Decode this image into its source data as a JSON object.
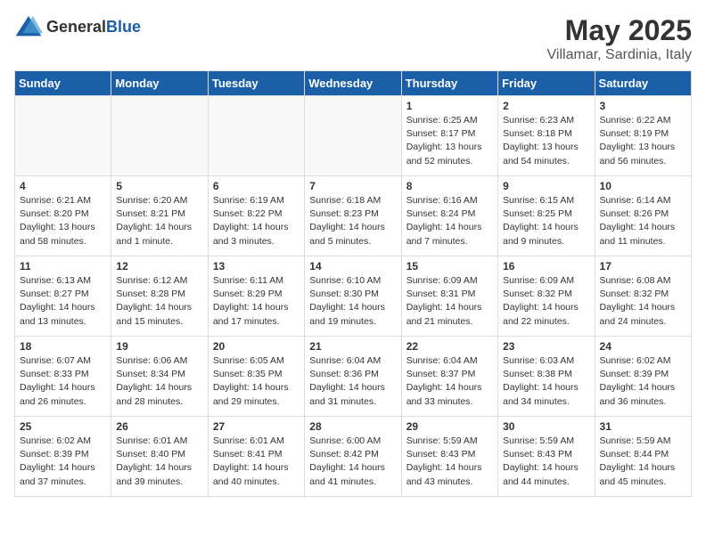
{
  "header": {
    "logo_general": "General",
    "logo_blue": "Blue",
    "month": "May 2025",
    "location": "Villamar, Sardinia, Italy"
  },
  "days_of_week": [
    "Sunday",
    "Monday",
    "Tuesday",
    "Wednesday",
    "Thursday",
    "Friday",
    "Saturday"
  ],
  "weeks": [
    [
      {
        "day": "",
        "content": ""
      },
      {
        "day": "",
        "content": ""
      },
      {
        "day": "",
        "content": ""
      },
      {
        "day": "",
        "content": ""
      },
      {
        "day": "1",
        "content": "Sunrise: 6:25 AM\nSunset: 8:17 PM\nDaylight: 13 hours\nand 52 minutes."
      },
      {
        "day": "2",
        "content": "Sunrise: 6:23 AM\nSunset: 8:18 PM\nDaylight: 13 hours\nand 54 minutes."
      },
      {
        "day": "3",
        "content": "Sunrise: 6:22 AM\nSunset: 8:19 PM\nDaylight: 13 hours\nand 56 minutes."
      }
    ],
    [
      {
        "day": "4",
        "content": "Sunrise: 6:21 AM\nSunset: 8:20 PM\nDaylight: 13 hours\nand 58 minutes."
      },
      {
        "day": "5",
        "content": "Sunrise: 6:20 AM\nSunset: 8:21 PM\nDaylight: 14 hours\nand 1 minute."
      },
      {
        "day": "6",
        "content": "Sunrise: 6:19 AM\nSunset: 8:22 PM\nDaylight: 14 hours\nand 3 minutes."
      },
      {
        "day": "7",
        "content": "Sunrise: 6:18 AM\nSunset: 8:23 PM\nDaylight: 14 hours\nand 5 minutes."
      },
      {
        "day": "8",
        "content": "Sunrise: 6:16 AM\nSunset: 8:24 PM\nDaylight: 14 hours\nand 7 minutes."
      },
      {
        "day": "9",
        "content": "Sunrise: 6:15 AM\nSunset: 8:25 PM\nDaylight: 14 hours\nand 9 minutes."
      },
      {
        "day": "10",
        "content": "Sunrise: 6:14 AM\nSunset: 8:26 PM\nDaylight: 14 hours\nand 11 minutes."
      }
    ],
    [
      {
        "day": "11",
        "content": "Sunrise: 6:13 AM\nSunset: 8:27 PM\nDaylight: 14 hours\nand 13 minutes."
      },
      {
        "day": "12",
        "content": "Sunrise: 6:12 AM\nSunset: 8:28 PM\nDaylight: 14 hours\nand 15 minutes."
      },
      {
        "day": "13",
        "content": "Sunrise: 6:11 AM\nSunset: 8:29 PM\nDaylight: 14 hours\nand 17 minutes."
      },
      {
        "day": "14",
        "content": "Sunrise: 6:10 AM\nSunset: 8:30 PM\nDaylight: 14 hours\nand 19 minutes."
      },
      {
        "day": "15",
        "content": "Sunrise: 6:09 AM\nSunset: 8:31 PM\nDaylight: 14 hours\nand 21 minutes."
      },
      {
        "day": "16",
        "content": "Sunrise: 6:09 AM\nSunset: 8:32 PM\nDaylight: 14 hours\nand 22 minutes."
      },
      {
        "day": "17",
        "content": "Sunrise: 6:08 AM\nSunset: 8:32 PM\nDaylight: 14 hours\nand 24 minutes."
      }
    ],
    [
      {
        "day": "18",
        "content": "Sunrise: 6:07 AM\nSunset: 8:33 PM\nDaylight: 14 hours\nand 26 minutes."
      },
      {
        "day": "19",
        "content": "Sunrise: 6:06 AM\nSunset: 8:34 PM\nDaylight: 14 hours\nand 28 minutes."
      },
      {
        "day": "20",
        "content": "Sunrise: 6:05 AM\nSunset: 8:35 PM\nDaylight: 14 hours\nand 29 minutes."
      },
      {
        "day": "21",
        "content": "Sunrise: 6:04 AM\nSunset: 8:36 PM\nDaylight: 14 hours\nand 31 minutes."
      },
      {
        "day": "22",
        "content": "Sunrise: 6:04 AM\nSunset: 8:37 PM\nDaylight: 14 hours\nand 33 minutes."
      },
      {
        "day": "23",
        "content": "Sunrise: 6:03 AM\nSunset: 8:38 PM\nDaylight: 14 hours\nand 34 minutes."
      },
      {
        "day": "24",
        "content": "Sunrise: 6:02 AM\nSunset: 8:39 PM\nDaylight: 14 hours\nand 36 minutes."
      }
    ],
    [
      {
        "day": "25",
        "content": "Sunrise: 6:02 AM\nSunset: 8:39 PM\nDaylight: 14 hours\nand 37 minutes."
      },
      {
        "day": "26",
        "content": "Sunrise: 6:01 AM\nSunset: 8:40 PM\nDaylight: 14 hours\nand 39 minutes."
      },
      {
        "day": "27",
        "content": "Sunrise: 6:01 AM\nSunset: 8:41 PM\nDaylight: 14 hours\nand 40 minutes."
      },
      {
        "day": "28",
        "content": "Sunrise: 6:00 AM\nSunset: 8:42 PM\nDaylight: 14 hours\nand 41 minutes."
      },
      {
        "day": "29",
        "content": "Sunrise: 5:59 AM\nSunset: 8:43 PM\nDaylight: 14 hours\nand 43 minutes."
      },
      {
        "day": "30",
        "content": "Sunrise: 5:59 AM\nSunset: 8:43 PM\nDaylight: 14 hours\nand 44 minutes."
      },
      {
        "day": "31",
        "content": "Sunrise: 5:59 AM\nSunset: 8:44 PM\nDaylight: 14 hours\nand 45 minutes."
      }
    ]
  ]
}
